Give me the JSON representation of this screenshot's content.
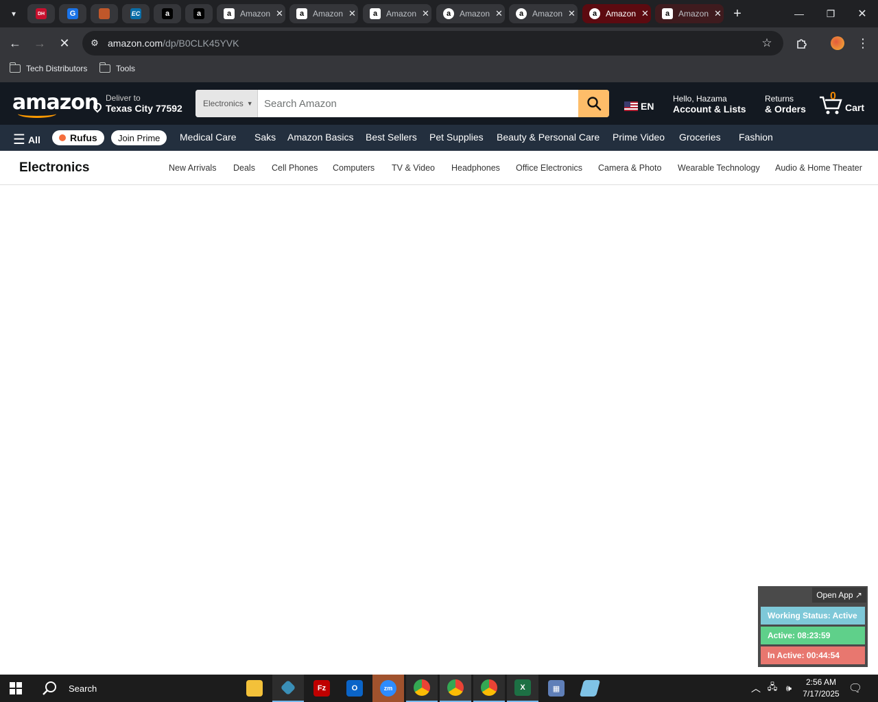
{
  "browser": {
    "tabs": [
      {
        "favicon": "DH",
        "title": "",
        "pinned": true
      },
      {
        "favicon": "G",
        "title": "",
        "pinned": true
      },
      {
        "favicon": "box",
        "title": "",
        "pinned": true
      },
      {
        "favicon": "EC",
        "title": "",
        "pinned": true
      },
      {
        "favicon": "a",
        "title": "",
        "pinned": true
      },
      {
        "favicon": "a",
        "title": "",
        "pinned": true
      },
      {
        "favicon": "a",
        "title": "Amazon",
        "pinned": false
      },
      {
        "favicon": "a",
        "title": "Amazon",
        "pinned": false
      },
      {
        "favicon": "a",
        "title": "Amazon",
        "pinned": false
      },
      {
        "favicon": "a",
        "title": "Amazon",
        "pinned": false
      },
      {
        "favicon": "a",
        "title": "Amazon",
        "pinned": false
      },
      {
        "favicon": "a",
        "title": "Amazon",
        "pinned": false,
        "active": true
      },
      {
        "favicon": "a",
        "title": "Amazon",
        "pinned": false
      }
    ],
    "url_host": "amazon.com",
    "url_path": "/dp/B0CLK45YVK",
    "bookmarks": [
      "Tech Distributors",
      "Tools"
    ]
  },
  "amazon": {
    "logo": "amazon",
    "deliver_line1": "Deliver to",
    "deliver_line2": "Texas City 77592",
    "search_category": "Electronics",
    "search_placeholder": "Search Amazon",
    "lang": "EN",
    "account_line1": "Hello, Hazama",
    "account_line2": "Account & Lists",
    "returns_line1": "Returns",
    "returns_line2": "& Orders",
    "cart_count": "0",
    "cart_label": "Cart",
    "subnav": {
      "all": "All",
      "rufus": "Rufus",
      "join_prime": "Join Prime",
      "items": [
        "Medical Care",
        "Saks",
        "Amazon Basics",
        "Best Sellers",
        "Pet Supplies",
        "Beauty & Personal Care",
        "Prime Video",
        "Groceries",
        "Fashion"
      ]
    },
    "electronics": {
      "title": "Electronics",
      "links": [
        "New Arrivals",
        "Deals",
        "Cell Phones",
        "Computers",
        "TV & Video",
        "Headphones",
        "Office Electronics",
        "Camera & Photo",
        "Wearable Technology",
        "Audio & Home Theater"
      ]
    }
  },
  "widget": {
    "open_app": "Open App ↗",
    "working_status": "Working Status: Active",
    "active": "Active: 08:23:59",
    "inactive": "In Active: 00:44:54",
    "colors": {
      "status": "#7ec8d8",
      "active": "#5fd08a",
      "inactive": "#e8776f"
    }
  },
  "taskbar": {
    "search": "Search",
    "time": "2:56 AM",
    "date": "7/17/2025"
  },
  "colors": {
    "amazon_nav": "#131921",
    "amazon_subnav": "#232f3e",
    "amazon_orange": "#febd69",
    "active_tab": "#5c0a10"
  }
}
